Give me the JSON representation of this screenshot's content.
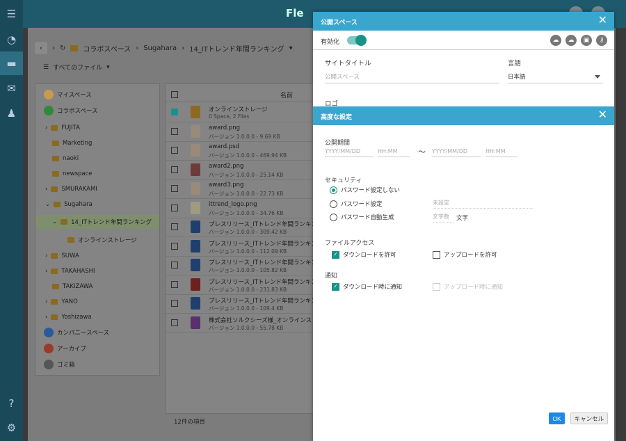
{
  "app": {
    "logo_text": "Fle"
  },
  "breadcrumb": {
    "items": [
      "コラボスペース",
      "Sugahara",
      "14_ITトレンド年間ランキング"
    ]
  },
  "filter": {
    "label": "すべてのファイル"
  },
  "tree": {
    "items": [
      {
        "label": "マイスペース"
      },
      {
        "label": "コラボスペース"
      },
      {
        "label": "FUJITA"
      },
      {
        "label": "Marketing"
      },
      {
        "label": "naoki"
      },
      {
        "label": "newspace"
      },
      {
        "label": "SMURAKAMI"
      },
      {
        "label": "Sugahara"
      },
      {
        "label": "14_ITトレンド年間ランキング"
      },
      {
        "label": "オンラインストレージ"
      },
      {
        "label": "SUWA"
      },
      {
        "label": "TAKAHASHI"
      },
      {
        "label": "TAKIZAWA"
      },
      {
        "label": "YANO"
      },
      {
        "label": "Yoshizawa"
      },
      {
        "label": "カンパニースペース"
      },
      {
        "label": "アーカイブ"
      },
      {
        "label": "ゴミ箱"
      }
    ]
  },
  "filelist": {
    "header": "名前",
    "rows": [
      {
        "name": "オンラインストレージ",
        "meta": "0 Space, 2 Files",
        "color": "#8a6a20"
      },
      {
        "name": "award.png",
        "meta": "バージョン 1.0.0.0 - 9.69 KB",
        "color": "#9a8a7a"
      },
      {
        "name": "award.psd",
        "meta": "バージョン 1.0.0.0 - 469.94 KB",
        "color": "#9a8a7a"
      },
      {
        "name": "award2.png",
        "meta": "バージョン 1.0.0.0 - 25.14 KB",
        "color": "#6e3a3a"
      },
      {
        "name": "award3.png",
        "meta": "バージョン 1.0.0.0 - 22.73 KB",
        "color": "#9a8a7a"
      },
      {
        "name": "ittrend_logo.png",
        "meta": "バージョン 1.0.0.0 - 34.76 KB",
        "color": "#a09a80"
      },
      {
        "name": "プレスリリース_ITトレンド年間ランキング",
        "meta": "バージョン 1.0.0.0 - 309.42 KB",
        "color": "#1f3f6e"
      },
      {
        "name": "プレスリリース_ITトレンド年間ランキング",
        "meta": "バージョン 1.0.0.0 - 112.09 KB",
        "color": "#1f3f6e"
      },
      {
        "name": "プレスリリース_ITトレンド年間ランキング",
        "meta": "バージョン 1.0.0.0 - 105.82 KB",
        "color": "#1f3f6e"
      },
      {
        "name": "プレスリリース_ITトレンド年間ランキング",
        "meta": "バージョン 1.0.0.0 - 231.83 KB",
        "color": "#6e1f1f"
      },
      {
        "name": "プレスリリース_ITトレンド年間ランキング",
        "meta": "バージョン 1.0.0.0 - 109.4 KB",
        "color": "#1f3f6e"
      },
      {
        "name": "株式会社ソルクシーズ様_オンラインストレージ",
        "meta": "バージョン 1.0.0.0 - 55.78 KB",
        "color": "#5a2f6e"
      }
    ],
    "count": "12件の項目"
  },
  "public_space": {
    "title": "公開スペース",
    "enable_label": "有効化",
    "site_title_label": "サイトタイトル",
    "site_title_placeholder": "公開スペース",
    "language_label": "言語",
    "language_value": "日本語",
    "logo_label": "ロゴ",
    "ok_label": "OK",
    "cancel_label": "キャンセル"
  },
  "advanced": {
    "title": "高度な設定",
    "period_label": "公開期間",
    "date_placeholder": "YYYY/MM/DD",
    "time_placeholder": "HH:MM",
    "tilde": "〜",
    "security_label": "セキュリティ",
    "radio_no_password": "パスワード設定しない",
    "radio_password": "パスワード設定",
    "radio_auto": "パスワード自動生成",
    "password_placeholder": "未設定",
    "length_placeholder": "文字数",
    "length_unit": "文字",
    "file_access_label": "ファイルアクセス",
    "allow_download": "ダウンロードを許可",
    "allow_upload": "アップロードを許可",
    "notify_label": "通知",
    "notify_download": "ダウンロード時に通知",
    "notify_upload": "アップロード時に通知"
  },
  "colors": {
    "dialog_header": "#3aa6ce",
    "accent": "#17938a",
    "ok_button": "#1e88e5"
  }
}
